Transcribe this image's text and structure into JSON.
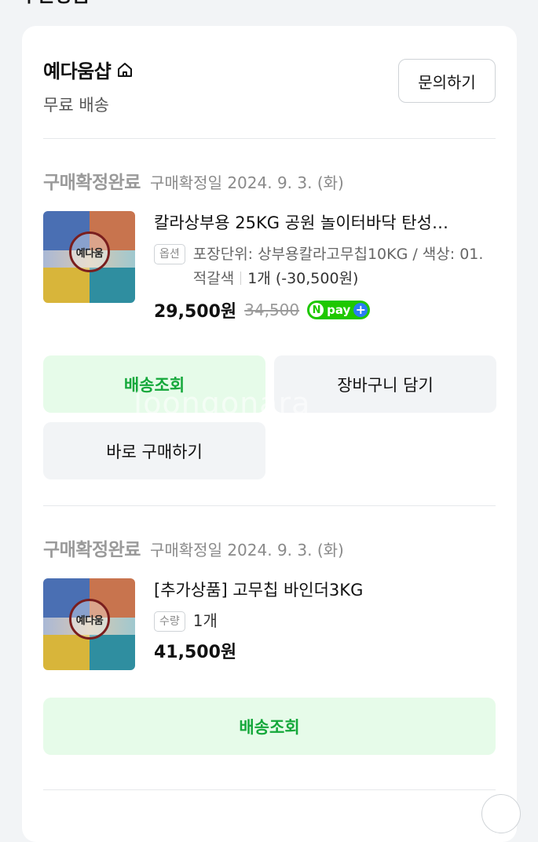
{
  "header": {
    "cut_title": "주문상품"
  },
  "shop": {
    "name": "예다움샵",
    "shipping": "무료 배송",
    "inquiry_label": "문의하기",
    "home_icon": "home-icon"
  },
  "orders": [
    {
      "status": "구매확정완료",
      "confirm_date": "구매확정일 2024. 9. 3. (화)",
      "logo_text": "예다움",
      "title": "칼라상부용 25KG 공원 놀이터바닥 탄성…",
      "option_badge": "옵션",
      "option_text": "포장단위: 상부용칼라고무칩10KG / 색상: 01.적갈색",
      "option_qty": "1개 (-30,500원)",
      "price": "29,500원",
      "original_price": "34,500",
      "npay_n": "N",
      "npay_text": "pay",
      "npay_plus": "+",
      "buttons": {
        "track": "배송조회",
        "cart": "장바구니 담기",
        "buy_now": "바로 구매하기"
      }
    },
    {
      "status": "구매확정완료",
      "confirm_date": "구매확정일 2024. 9. 3. (화)",
      "logo_text": "예다움",
      "title": "[추가상품] 고무칩 바인더3KG",
      "option_badge": "수량",
      "option_qty": "1개",
      "price": "41,500원",
      "buttons": {
        "track": "배송조회"
      }
    }
  ],
  "watermark": "Joongonara",
  "colors": {
    "accent_green": "#15a83b",
    "green_button_bg": "#e6fbe9",
    "gray_button_bg": "#f2f4f6",
    "npay_green": "#1ec800",
    "npay_blue": "#2a7cf6"
  }
}
